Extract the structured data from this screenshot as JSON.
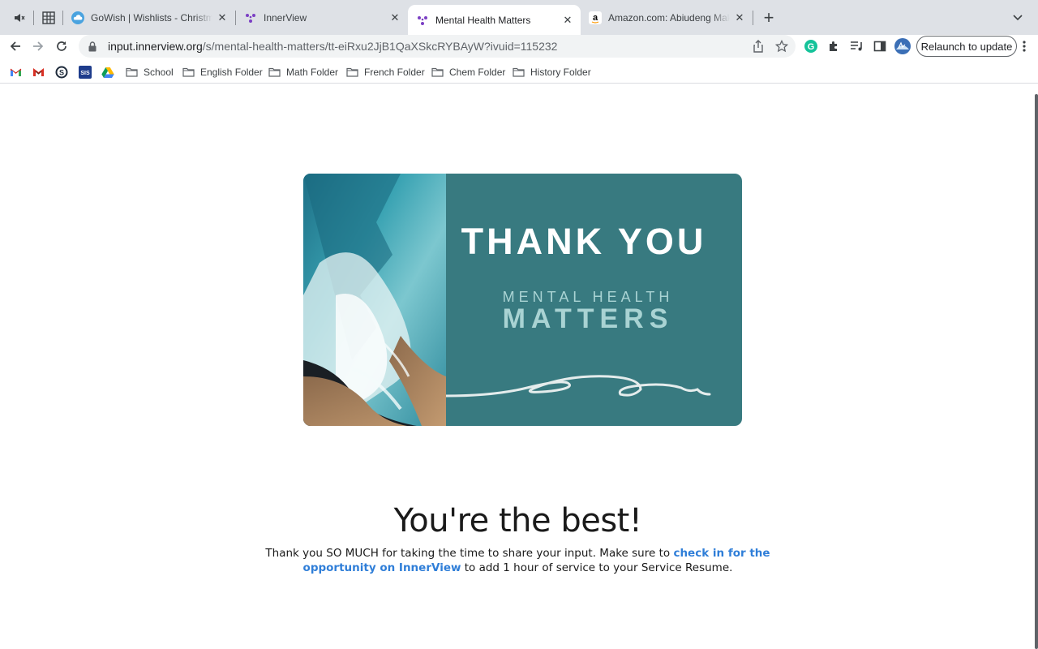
{
  "browser": {
    "tabs": [
      {
        "title": "GoWish | Wishlists - Christmas",
        "favicon": "cloud-icon",
        "active": false
      },
      {
        "title": "InnerView",
        "favicon": "innerview-icon",
        "active": false
      },
      {
        "title": "Mental Health Matters",
        "favicon": "innerview-icon",
        "active": true
      },
      {
        "title": "Amazon.com: Abiudeng Makeup",
        "favicon": "amazon-icon",
        "active": false
      }
    ],
    "url_host": "input.innerview.org",
    "url_path": "/s/mental-health-matters/tt-eiRxu2JjB1QaXSkcRYBAyW?ivuid=115232",
    "relaunch_label": "Relaunch to update",
    "bookmarks": [
      {
        "label": "School"
      },
      {
        "label": "English Folder"
      },
      {
        "label": "Math Folder"
      },
      {
        "label": "French Folder"
      },
      {
        "label": "Chem Folder"
      },
      {
        "label": "History Folder"
      }
    ],
    "bookmark_icons": [
      "gmail-icon",
      "gmail-red-icon",
      "schoology-icon",
      "sis-icon",
      "google-drive-icon"
    ],
    "sis_label": "SIS",
    "colors": {
      "tabstrip": "#dee1e6",
      "omnibox": "#f1f3f4",
      "link": "#2f7ed8",
      "banner": "#387a80"
    }
  },
  "page": {
    "banner": {
      "title": "THANK YOU",
      "line1": "MENTAL HEALTH",
      "line2": "MATTERS"
    },
    "headline": "You're the best!",
    "body_before": "Thank you SO MUCH for taking the time to share your input. Make sure to ",
    "body_link": "check in for the opportunity on InnerView",
    "body_after": " to add 1 hour of service to your Service Resume."
  }
}
